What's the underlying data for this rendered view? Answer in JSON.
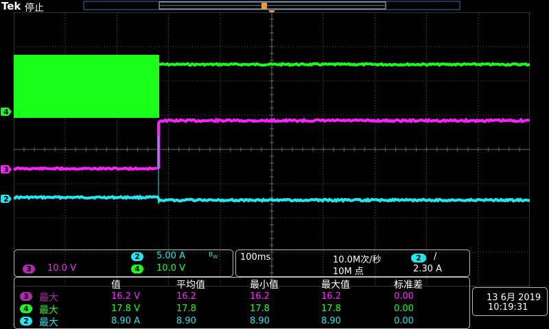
{
  "header": {
    "brand": "Tek",
    "status": "停止"
  },
  "trigger_marker": "T",
  "channels": {
    "ch4": {
      "number": "4",
      "color": "#1aff1a"
    },
    "ch3": {
      "number": "3",
      "color": "#ff22ff"
    },
    "ch2": {
      "number": "2",
      "color": "#20e8ee"
    }
  },
  "vertical_panel": {
    "ch2_scale": "5.00 A",
    "ch2_bw": "B",
    "ch2_bw_sub": "W",
    "ch3_scale": "10.0 V",
    "ch4_scale": "10.0 V"
  },
  "horizontal_panel": {
    "timebase": "100ms",
    "sample_rate": "10.0M次/秒",
    "record_length": "10M 点",
    "trigger_source": "2",
    "trigger_slope": "/",
    "trigger_level": "2.30 A"
  },
  "measurements": {
    "headers": [
      "值",
      "平均值",
      "最小值",
      "最大值",
      "标准差"
    ],
    "rows": [
      {
        "channel": "3",
        "label": "最大",
        "color": "#ff22ff",
        "values": [
          "16.2 V",
          "16.2",
          "16.2",
          "16.2",
          "0.00"
        ]
      },
      {
        "channel": "4",
        "label": "最大",
        "color": "#1aff1a",
        "values": [
          "17.8 V",
          "17.8",
          "17.8",
          "17.8",
          "0.00"
        ]
      },
      {
        "channel": "2",
        "label": "最大",
        "color": "#20e8ee",
        "values": [
          "8.90 A",
          "8.90",
          "8.90",
          "8.90",
          "0.00"
        ]
      }
    ]
  },
  "datetime": {
    "date": "13 6月 2019",
    "time": "10:19:31"
  }
}
